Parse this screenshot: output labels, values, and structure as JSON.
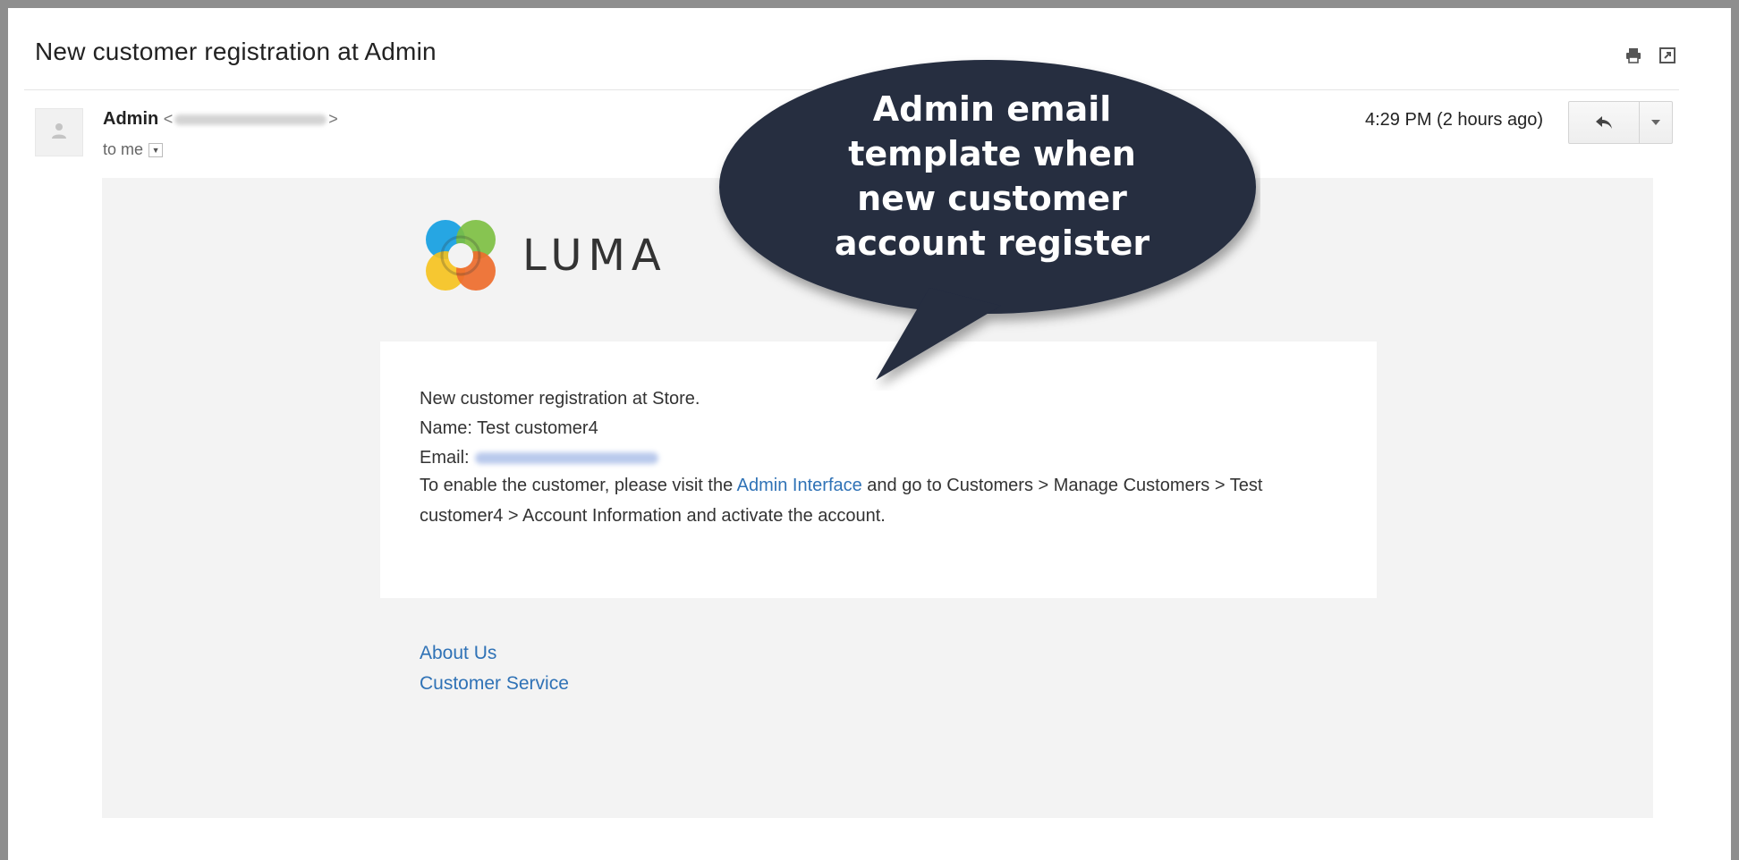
{
  "email": {
    "subject": "New customer registration at Admin",
    "sender_name": "Admin",
    "sender_open": "<",
    "sender_close": ">",
    "to": "to me",
    "timestamp": "4:29 PM (2 hours ago)"
  },
  "body": {
    "logo_text": "LUMA",
    "line1": "New customer registration at Store.",
    "line2": "Name: Test customer4",
    "email_label": "Email:",
    "para_start": "To enable the customer, please visit the ",
    "para_link": "Admin Interface",
    "para_end": " and go to Customers > Manage Customers > Test customer4 > Account Information and activate the account."
  },
  "footer": {
    "about": "About Us",
    "service": "Customer Service"
  },
  "callout": {
    "text": "Admin email\ntemplate when\nnew customer\naccount register"
  },
  "colors": {
    "link": "#2f72b6",
    "bubble": "#252d40",
    "email_bg": "#f3f3f3"
  }
}
